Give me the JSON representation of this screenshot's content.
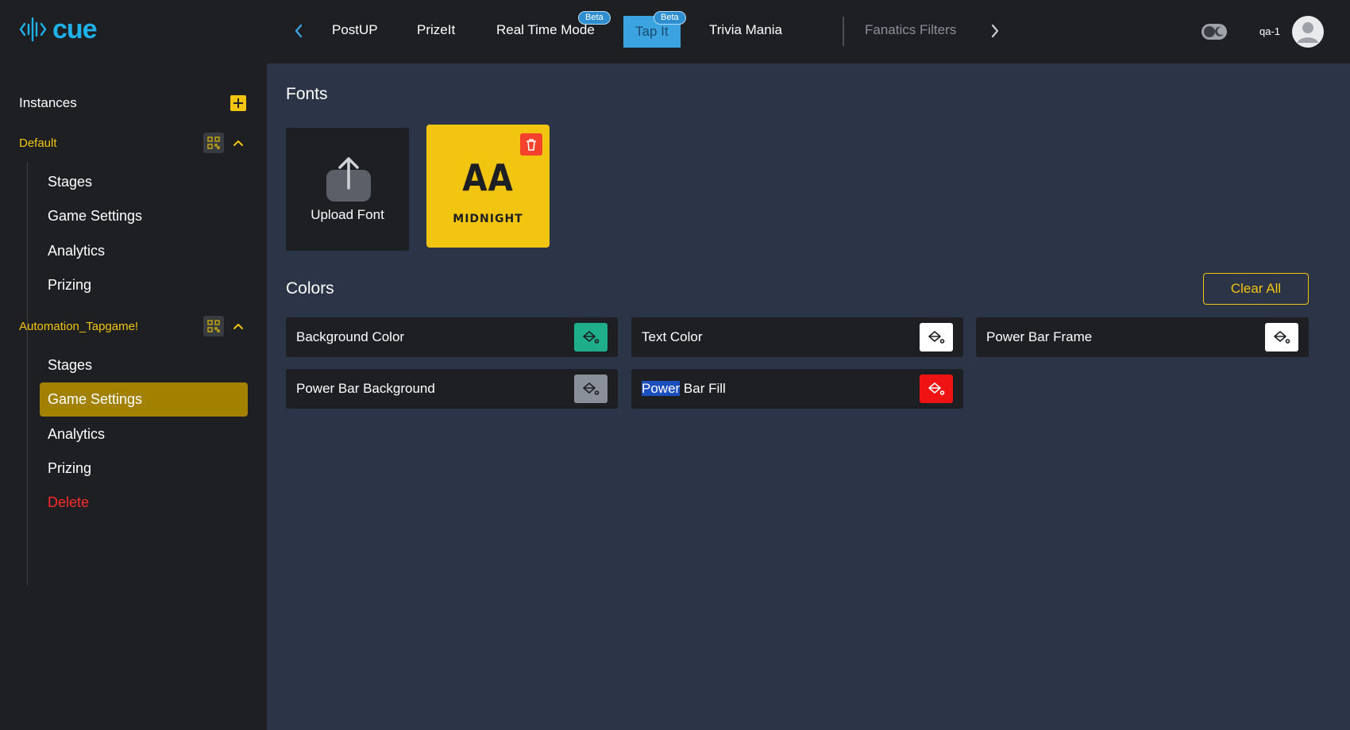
{
  "app": {
    "brand": "cue",
    "logo_icon": "sound-wave-icon"
  },
  "header": {
    "tabs": [
      {
        "label": "PostUP",
        "state": "normal"
      },
      {
        "label": "PrizeIt",
        "state": "normal"
      },
      {
        "label": "Real Time Mode",
        "state": "normal",
        "badge": "Beta"
      },
      {
        "label": "Tap It",
        "state": "active",
        "badge": "Beta"
      },
      {
        "label": "Trivia Mania",
        "state": "normal"
      },
      {
        "label": "Fanatics Filters",
        "state": "disabled"
      }
    ],
    "username": "qa-1"
  },
  "sidebar": {
    "title": "Instances",
    "groups": [
      {
        "label": "Default",
        "items": [
          "Stages",
          "Game Settings",
          "Analytics",
          "Prizing"
        ]
      },
      {
        "label": "Automation_Tapgame!",
        "items": [
          "Stages",
          "Game Settings",
          "Analytics",
          "Prizing",
          "Delete"
        ],
        "selected": "Game Settings"
      }
    ]
  },
  "main": {
    "fonts": {
      "title": "Fonts",
      "upload_label": "Upload Font",
      "cards": [
        {
          "preview": "AA",
          "name": "MIDNIGHT"
        }
      ]
    },
    "colors": {
      "title": "Colors",
      "clear_label": "Clear All",
      "items": [
        {
          "label": "Background Color",
          "color": "#1fae8a"
        },
        {
          "label": "Text Color",
          "color": "#ffffff"
        },
        {
          "label": "Power Bar Frame",
          "color": "#ffffff"
        },
        {
          "label": "Power Bar Background",
          "color": "#8a9099"
        },
        {
          "label_highlighted": "Power",
          "label_rest": " Bar Fill",
          "color": "#f01313"
        }
      ]
    }
  },
  "colors": {
    "accent": "#f2c511",
    "active_tab": "#3aa3e0",
    "danger": "#ff2b2b",
    "panel": "#1d1f22",
    "background": "#2c3548"
  }
}
